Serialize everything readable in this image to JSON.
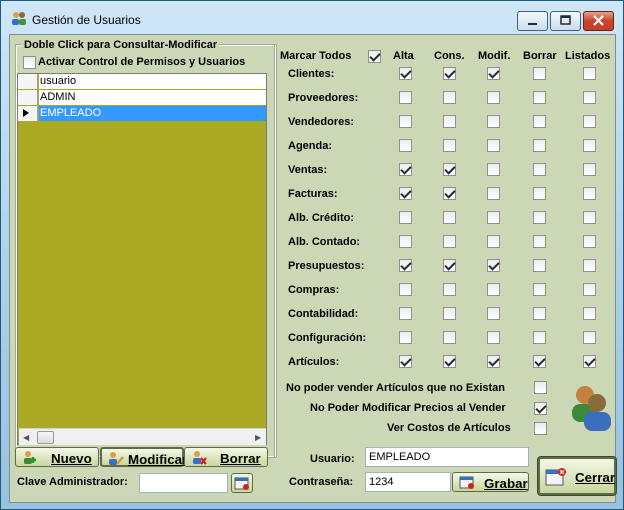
{
  "window": {
    "title": "Gestión de Usuarios"
  },
  "left_panel": {
    "group_label": "Doble Click para Consultar-Modificar",
    "activate_label": "Activar Control de Permisos y Usuarios",
    "activate_checked": false,
    "grid": {
      "column_header": "usuario",
      "rows": [
        "ADMIN",
        "EMPLEADO"
      ],
      "selected_index": 1
    },
    "buttons": {
      "new": "Nuevo",
      "modify": "Modificar",
      "delete": "Borrar"
    },
    "admin_key_label": "Clave Administrador:",
    "admin_key_value": ""
  },
  "permissions": {
    "mark_all_label": "Marcar Todos",
    "mark_all_checked": true,
    "columns": [
      "Alta",
      "Cons.",
      "Modif.",
      "Borrar",
      "Listados"
    ],
    "rows": [
      {
        "label": "Clientes:",
        "checks": [
          true,
          true,
          true,
          false,
          false
        ]
      },
      {
        "label": "Proveedores:",
        "checks": [
          false,
          false,
          false,
          false,
          false
        ]
      },
      {
        "label": "Vendedores:",
        "checks": [
          false,
          false,
          false,
          false,
          false
        ]
      },
      {
        "label": "Agenda:",
        "checks": [
          false,
          false,
          false,
          false,
          false
        ]
      },
      {
        "label": "Ventas:",
        "checks": [
          true,
          true,
          false,
          false,
          false
        ]
      },
      {
        "label": "Facturas:",
        "checks": [
          true,
          true,
          false,
          false,
          false
        ]
      },
      {
        "label": "Alb. Crédito:",
        "checks": [
          false,
          false,
          false,
          false,
          false
        ]
      },
      {
        "label": "Alb. Contado:",
        "checks": [
          false,
          false,
          false,
          false,
          false
        ]
      },
      {
        "label": "Presupuestos:",
        "checks": [
          true,
          true,
          true,
          false,
          false
        ]
      },
      {
        "label": "Compras:",
        "checks": [
          false,
          false,
          false,
          false,
          false
        ]
      },
      {
        "label": "Contabilidad:",
        "checks": [
          false,
          false,
          false,
          false,
          false
        ]
      },
      {
        "label": "Configuración:",
        "checks": [
          false,
          false,
          false,
          false,
          false
        ]
      },
      {
        "label": "Artículos:",
        "checks": [
          true,
          true,
          true,
          true,
          true
        ]
      }
    ]
  },
  "options": [
    {
      "label": "No poder vender Artículos que no Existan",
      "checked": false
    },
    {
      "label": "No Poder Modificar Precios al Vender",
      "checked": true
    },
    {
      "label": "Ver Costos de Artículos",
      "checked": false
    }
  ],
  "user_form": {
    "user_label": "Usuario:",
    "user_value": "EMPLEADO",
    "password_label": "Contraseña:",
    "password_value": "1234",
    "save_label": "Grabar"
  },
  "close_label": "Cerrar",
  "colors": {
    "panel": "#ccd7b6",
    "grid_background": "#aaaa23",
    "selection": "#3399ff"
  }
}
